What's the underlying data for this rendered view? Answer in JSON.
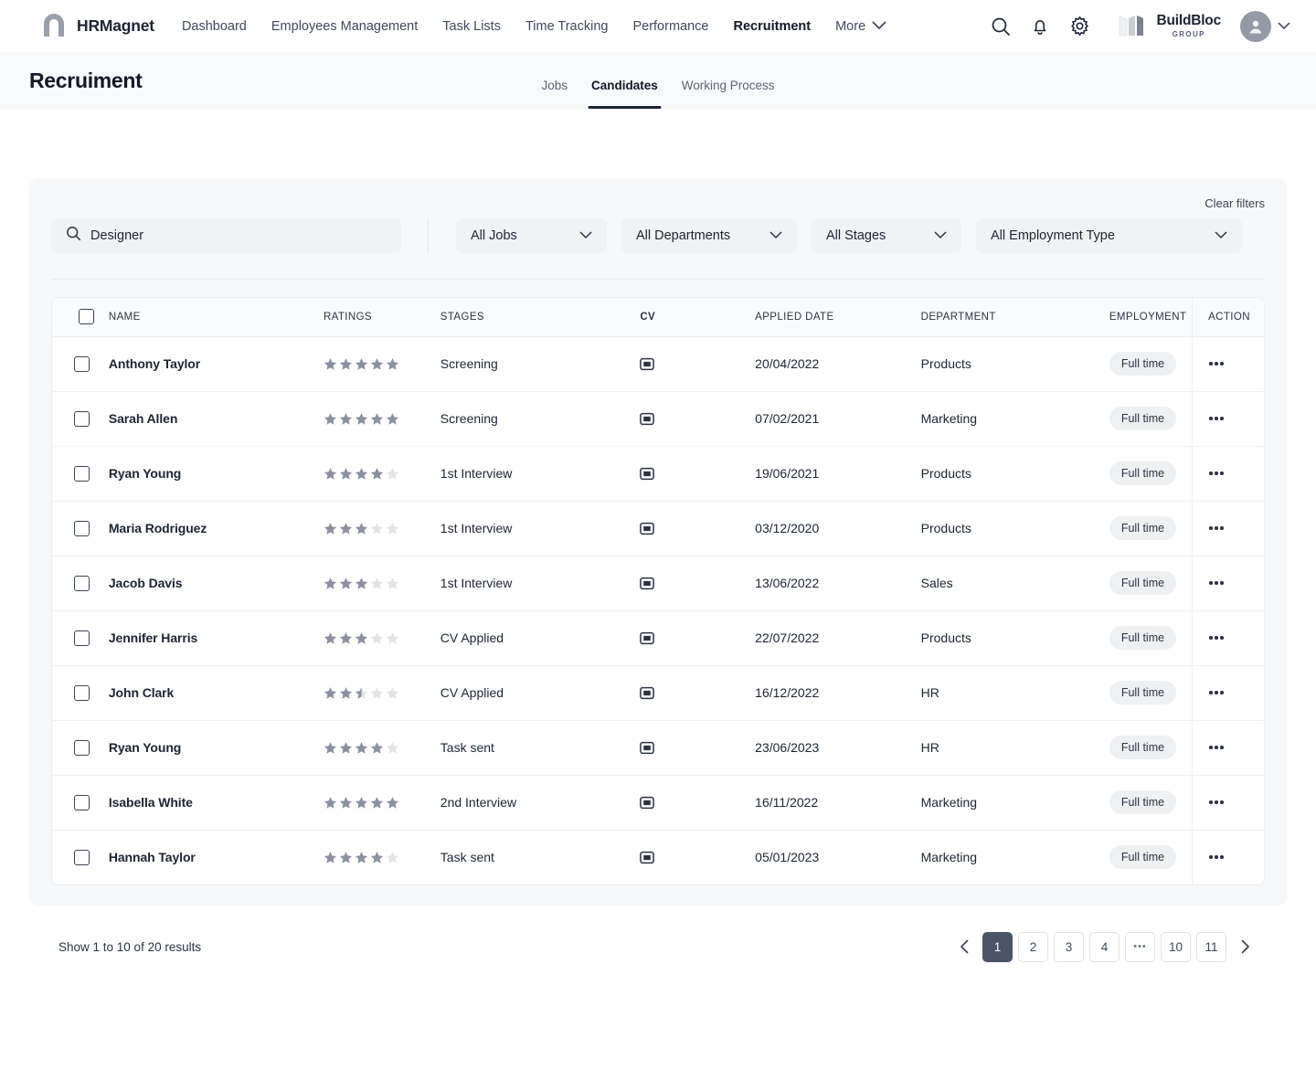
{
  "nav": {
    "brand": "HRMagnet",
    "links": [
      {
        "label": "Dashboard",
        "active": false
      },
      {
        "label": "Employees Management",
        "active": false
      },
      {
        "label": "Task Lists",
        "active": false
      },
      {
        "label": "Time Tracking",
        "active": false
      },
      {
        "label": "Performance",
        "active": false
      },
      {
        "label": "Recruitment",
        "active": true
      }
    ],
    "more_label": "More",
    "icons": [
      "search-icon",
      "bell-icon",
      "gear-icon"
    ],
    "company_name": "BuildBloc",
    "company_sub": "GROUP"
  },
  "page": {
    "title": "Recruiment",
    "tabs": [
      {
        "label": "Jobs",
        "active": false
      },
      {
        "label": "Candidates",
        "active": true
      },
      {
        "label": "Working Process",
        "active": false
      }
    ]
  },
  "filters": {
    "clear_label": "Clear filters",
    "search_value": "Designer",
    "search_placeholder": "Search",
    "selects": [
      {
        "label": "All Jobs"
      },
      {
        "label": "All Departments"
      },
      {
        "label": "All Stages"
      },
      {
        "label": "All Employment Type"
      }
    ]
  },
  "table": {
    "columns": [
      "NAME",
      "RATINGS",
      "STAGES",
      "CV",
      "APPLIED DATE",
      "DEPARTMENT",
      "EMPLOYMENT",
      "ACTION"
    ],
    "rows": [
      {
        "name": "Anthony Taylor",
        "rating": 5,
        "stage": "Screening",
        "date": "20/04/2022",
        "department": "Products",
        "employment": "Full time"
      },
      {
        "name": "Sarah Allen",
        "rating": 5,
        "stage": "Screening",
        "date": "07/02/2021",
        "department": "Marketing",
        "employment": "Full time"
      },
      {
        "name": "Ryan Young",
        "rating": 4,
        "stage": "1st Interview",
        "date": "19/06/2021",
        "department": "Products",
        "employment": "Full time"
      },
      {
        "name": "Maria Rodriguez",
        "rating": 3,
        "stage": "1st Interview",
        "date": "03/12/2020",
        "department": "Products",
        "employment": "Full time"
      },
      {
        "name": "Jacob Davis",
        "rating": 3,
        "stage": "1st Interview",
        "date": "13/06/2022",
        "department": "Sales",
        "employment": "Full time"
      },
      {
        "name": "Jennifer Harris",
        "rating": 3,
        "stage": "CV Applied",
        "date": "22/07/2022",
        "department": "Products",
        "employment": "Full time"
      },
      {
        "name": "John Clark",
        "rating": 2.5,
        "stage": "CV Applied",
        "date": "16/12/2022",
        "department": "HR",
        "employment": "Full time"
      },
      {
        "name": "Ryan Young",
        "rating": 4,
        "stage": "Task sent",
        "date": "23/06/2023",
        "department": "HR",
        "employment": "Full time"
      },
      {
        "name": "Isabella White",
        "rating": 5,
        "stage": "2nd Interview",
        "date": "16/11/2022",
        "department": "Marketing",
        "employment": "Full time"
      },
      {
        "name": "Hannah Taylor",
        "rating": 4,
        "stage": "Task sent",
        "date": "05/01/2023",
        "department": "Marketing",
        "employment": "Full time"
      }
    ]
  },
  "footer": {
    "results_text": "Show 1 to 10 of 20 results",
    "pages": [
      {
        "label": "1",
        "active": true
      },
      {
        "label": "2",
        "active": false
      },
      {
        "label": "3",
        "active": false
      },
      {
        "label": "4",
        "active": false
      },
      {
        "label": "•••",
        "active": false,
        "ellipsis": true
      },
      {
        "label": "10",
        "active": false
      },
      {
        "label": "11",
        "active": false
      }
    ]
  },
  "colors": {
    "accent": "#4c5468",
    "star_filled": "#8c91a0",
    "star_empty": "#e2e4e8",
    "page_bg": "#f8f9fa",
    "card_bg": "#f7f8f9"
  }
}
